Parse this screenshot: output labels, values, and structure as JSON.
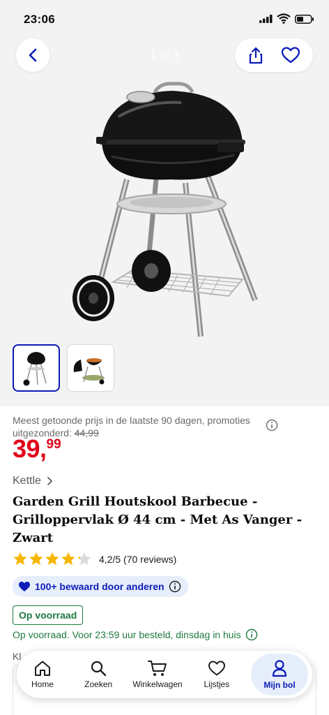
{
  "status_bar": {
    "time": "23:06"
  },
  "gallery": {
    "counter": "1 of 3"
  },
  "price": {
    "note_prefix": "Meest getoonde prijs in de laatste 90 dagen, promoties uitgezonderd:",
    "old_price": "44,99",
    "main": "39,",
    "cents": "99"
  },
  "product": {
    "brand": "Kettle",
    "title": "Garden Grill Houtskool Barbecue - Grilloppervlak Ø 44 cm - Met As Vanger - Zwart",
    "rating_value": 4.2,
    "rating_text": "4,2/5 (70 reviews)",
    "saved_text": "100+ bewaard door anderen",
    "stock_label": "Op voorraad",
    "delivery_text": "Op voorraad. Voor 23:59 uur besteld, dinsdag in huis",
    "cut_text": "Kl"
  },
  "tabs": [
    {
      "label": "Home",
      "icon": "home-icon"
    },
    {
      "label": "Zoeken",
      "icon": "search-icon"
    },
    {
      "label": "Winkelwagen",
      "icon": "cart-icon"
    },
    {
      "label": "Lijstjes",
      "icon": "heart-icon"
    },
    {
      "label": "Mijn bol",
      "icon": "user-icon"
    }
  ],
  "colors": {
    "accent": "#0b1bb8",
    "price": "#e0001b",
    "stock": "#1e7a41",
    "star": "#f5b400"
  }
}
